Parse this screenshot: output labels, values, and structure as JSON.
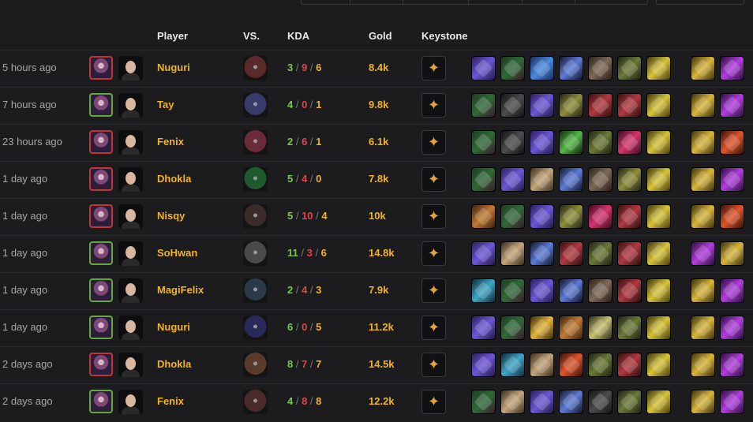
{
  "header": {
    "player": "Player",
    "vs": "VS.",
    "kda": "KDA",
    "gold": "Gold",
    "keystone": "Keystone"
  },
  "colors": {
    "background": "#1c1c1e",
    "player_name": "#f2b320",
    "kills": "#7ac74f",
    "deaths": "#e0434a",
    "assists": "#f2b320",
    "loss_border": "#c2333a",
    "win_border": "#64a83b"
  },
  "rows": [
    {
      "time": "5 hours ago",
      "result": "loss",
      "player": "Nuguri",
      "k": "3",
      "d": "9",
      "a": "6",
      "gold": "8.4k",
      "vs_color": "#5a2a2a",
      "items": [
        "i-sword",
        "i-hood",
        "i-crystal",
        "i-blade",
        "i-axe",
        "i-boots",
        "i-yellow"
      ],
      "spells": [
        "i-gold",
        "i-purple"
      ]
    },
    {
      "time": "7 hours ago",
      "result": "win",
      "player": "Tay",
      "k": "4",
      "d": "0",
      "a": "1",
      "gold": "9.8k",
      "vs_color": "#3a3a6a",
      "items": [
        "i-hood",
        "i-dark",
        "i-sword",
        "i-olive",
        "i-red",
        "i-red",
        "i-yellow"
      ],
      "spells": [
        "i-gold",
        "i-purple"
      ]
    },
    {
      "time": "23 hours ago",
      "result": "loss",
      "player": "Fenix",
      "k": "2",
      "d": "6",
      "a": "1",
      "gold": "6.1k",
      "vs_color": "#6a2a3a",
      "items": [
        "i-hood",
        "i-dark",
        "i-sword",
        "i-green",
        "i-boots",
        "i-pink",
        "i-yellow"
      ],
      "spells": [
        "i-gold",
        "i-fire"
      ]
    },
    {
      "time": "1 day ago",
      "result": "loss",
      "player": "Dhokla",
      "k": "5",
      "d": "4",
      "a": "0",
      "gold": "7.8k",
      "vs_color": "#1f5a2f",
      "items": [
        "i-hood",
        "i-sword",
        "i-shell",
        "i-blade",
        "i-axe",
        "i-olive",
        "i-yellow"
      ],
      "spells": [
        "i-gold",
        "i-purple"
      ]
    },
    {
      "time": "1 day ago",
      "result": "loss",
      "player": "Nisqy",
      "k": "5",
      "d": "10",
      "a": "4",
      "gold": "10k",
      "vs_color": "#3a2a2a",
      "items": [
        "i-bronze",
        "i-hood",
        "i-sword",
        "i-olive",
        "i-pink",
        "i-red",
        "i-yellow"
      ],
      "spells": [
        "i-gold",
        "i-fire"
      ]
    },
    {
      "time": "1 day ago",
      "result": "win",
      "player": "SoHwan",
      "k": "11",
      "d": "3",
      "a": "6",
      "gold": "14.8k",
      "vs_color": "#4a4a4a",
      "items": [
        "i-sword",
        "i-shell",
        "i-blade",
        "i-red",
        "i-boots",
        "i-red",
        "i-yellow"
      ],
      "spells": [
        "i-purple",
        "i-gold"
      ]
    },
    {
      "time": "1 day ago",
      "result": "win",
      "player": "MagiFelix",
      "k": "2",
      "d": "4",
      "a": "3",
      "gold": "7.9k",
      "vs_color": "#2a3a4a",
      "items": [
        "i-ice",
        "i-hood",
        "i-sword",
        "i-blade",
        "i-axe",
        "i-red",
        "i-yellow"
      ],
      "spells": [
        "i-gold",
        "i-purple"
      ]
    },
    {
      "time": "1 day ago",
      "result": "win",
      "player": "Nuguri",
      "k": "6",
      "d": "0",
      "a": "5",
      "gold": "11.2k",
      "vs_color": "#2a2a5a",
      "items": [
        "i-sword",
        "i-hood",
        "i-shield",
        "i-bronze",
        "i-tri",
        "i-boots",
        "i-yellow"
      ],
      "spells": [
        "i-gold",
        "i-purple"
      ]
    },
    {
      "time": "2 days ago",
      "result": "loss",
      "player": "Dhokla",
      "k": "8",
      "d": "7",
      "a": "7",
      "gold": "14.5k",
      "vs_color": "#5a3a2a",
      "items": [
        "i-sword",
        "i-ice",
        "i-shell",
        "i-fire",
        "i-boots",
        "i-red",
        "i-yellow"
      ],
      "spells": [
        "i-gold",
        "i-purple"
      ]
    },
    {
      "time": "2 days ago",
      "result": "win",
      "player": "Fenix",
      "k": "4",
      "d": "8",
      "a": "8",
      "gold": "12.2k",
      "vs_color": "#4a2a2a",
      "items": [
        "i-hood",
        "i-shell",
        "i-sword",
        "i-blade",
        "i-dark",
        "i-boots",
        "i-yellow"
      ],
      "spells": [
        "i-gold",
        "i-purple"
      ]
    }
  ]
}
